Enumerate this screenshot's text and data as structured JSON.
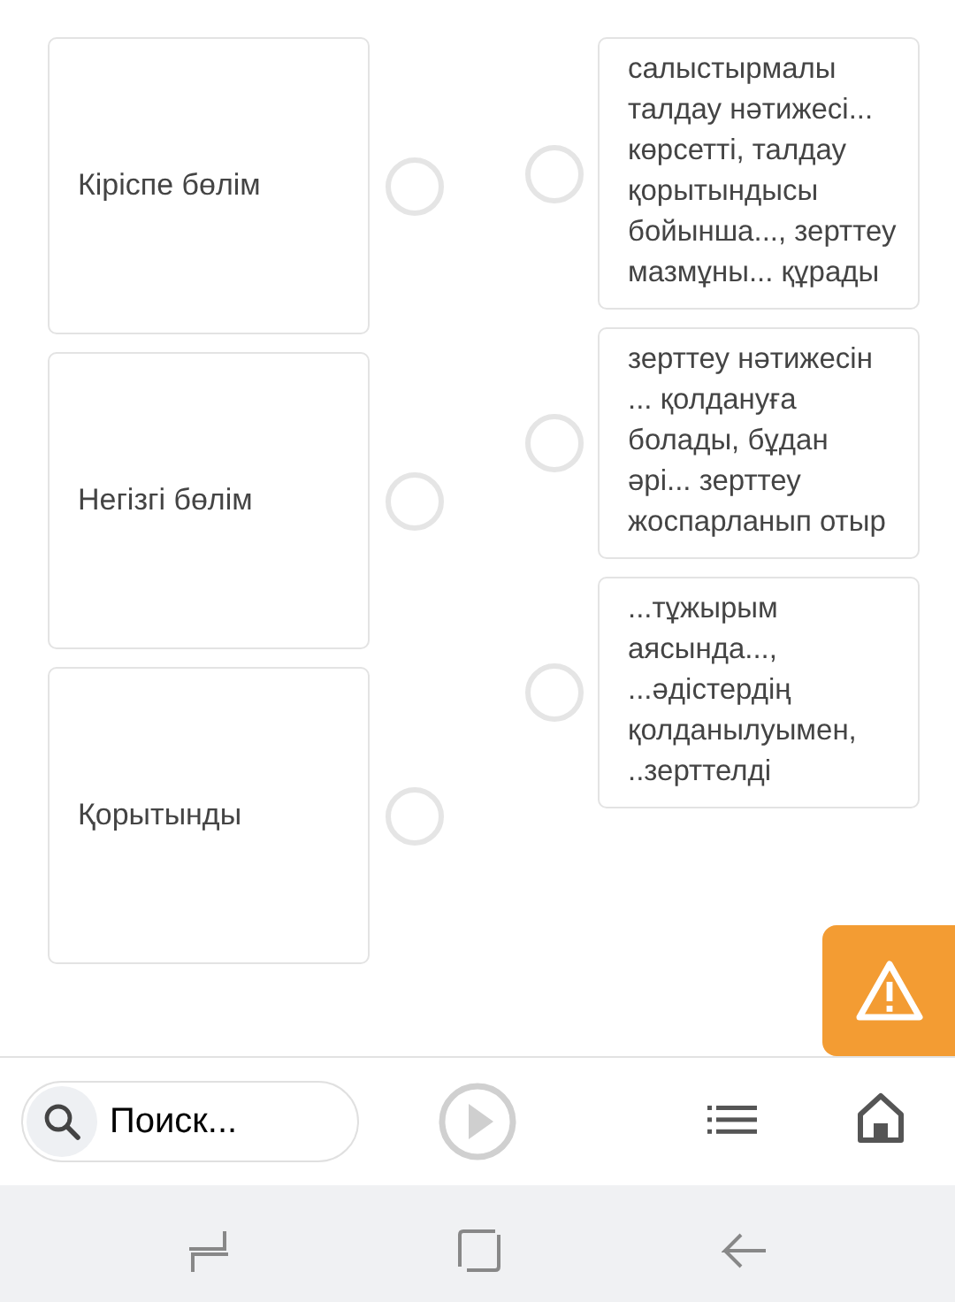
{
  "left_items": [
    {
      "label": "Кіріспе бөлім",
      "selected": false
    },
    {
      "label": "Негізгі бөлім",
      "selected": false
    },
    {
      "label": "Қорытынды",
      "selected": false
    }
  ],
  "right_items": [
    {
      "text": "салыстырмалы талдау нәтижесі... көрсетті, талдау қорытындысы бойынша..., зерттеу мазмұны... құрады",
      "selected": false
    },
    {
      "text": "зерттеу нәтижесін ... қолдануға болады, бұдан әрі... зерттеу жоспарланып отыр",
      "selected": false
    },
    {
      "text": "...тұжырым аясында..., ...әдістердің қолданылуымен, ..зерттелді",
      "selected": false
    }
  ],
  "toolbar": {
    "search": {
      "placeholder": "Поиск..."
    }
  }
}
